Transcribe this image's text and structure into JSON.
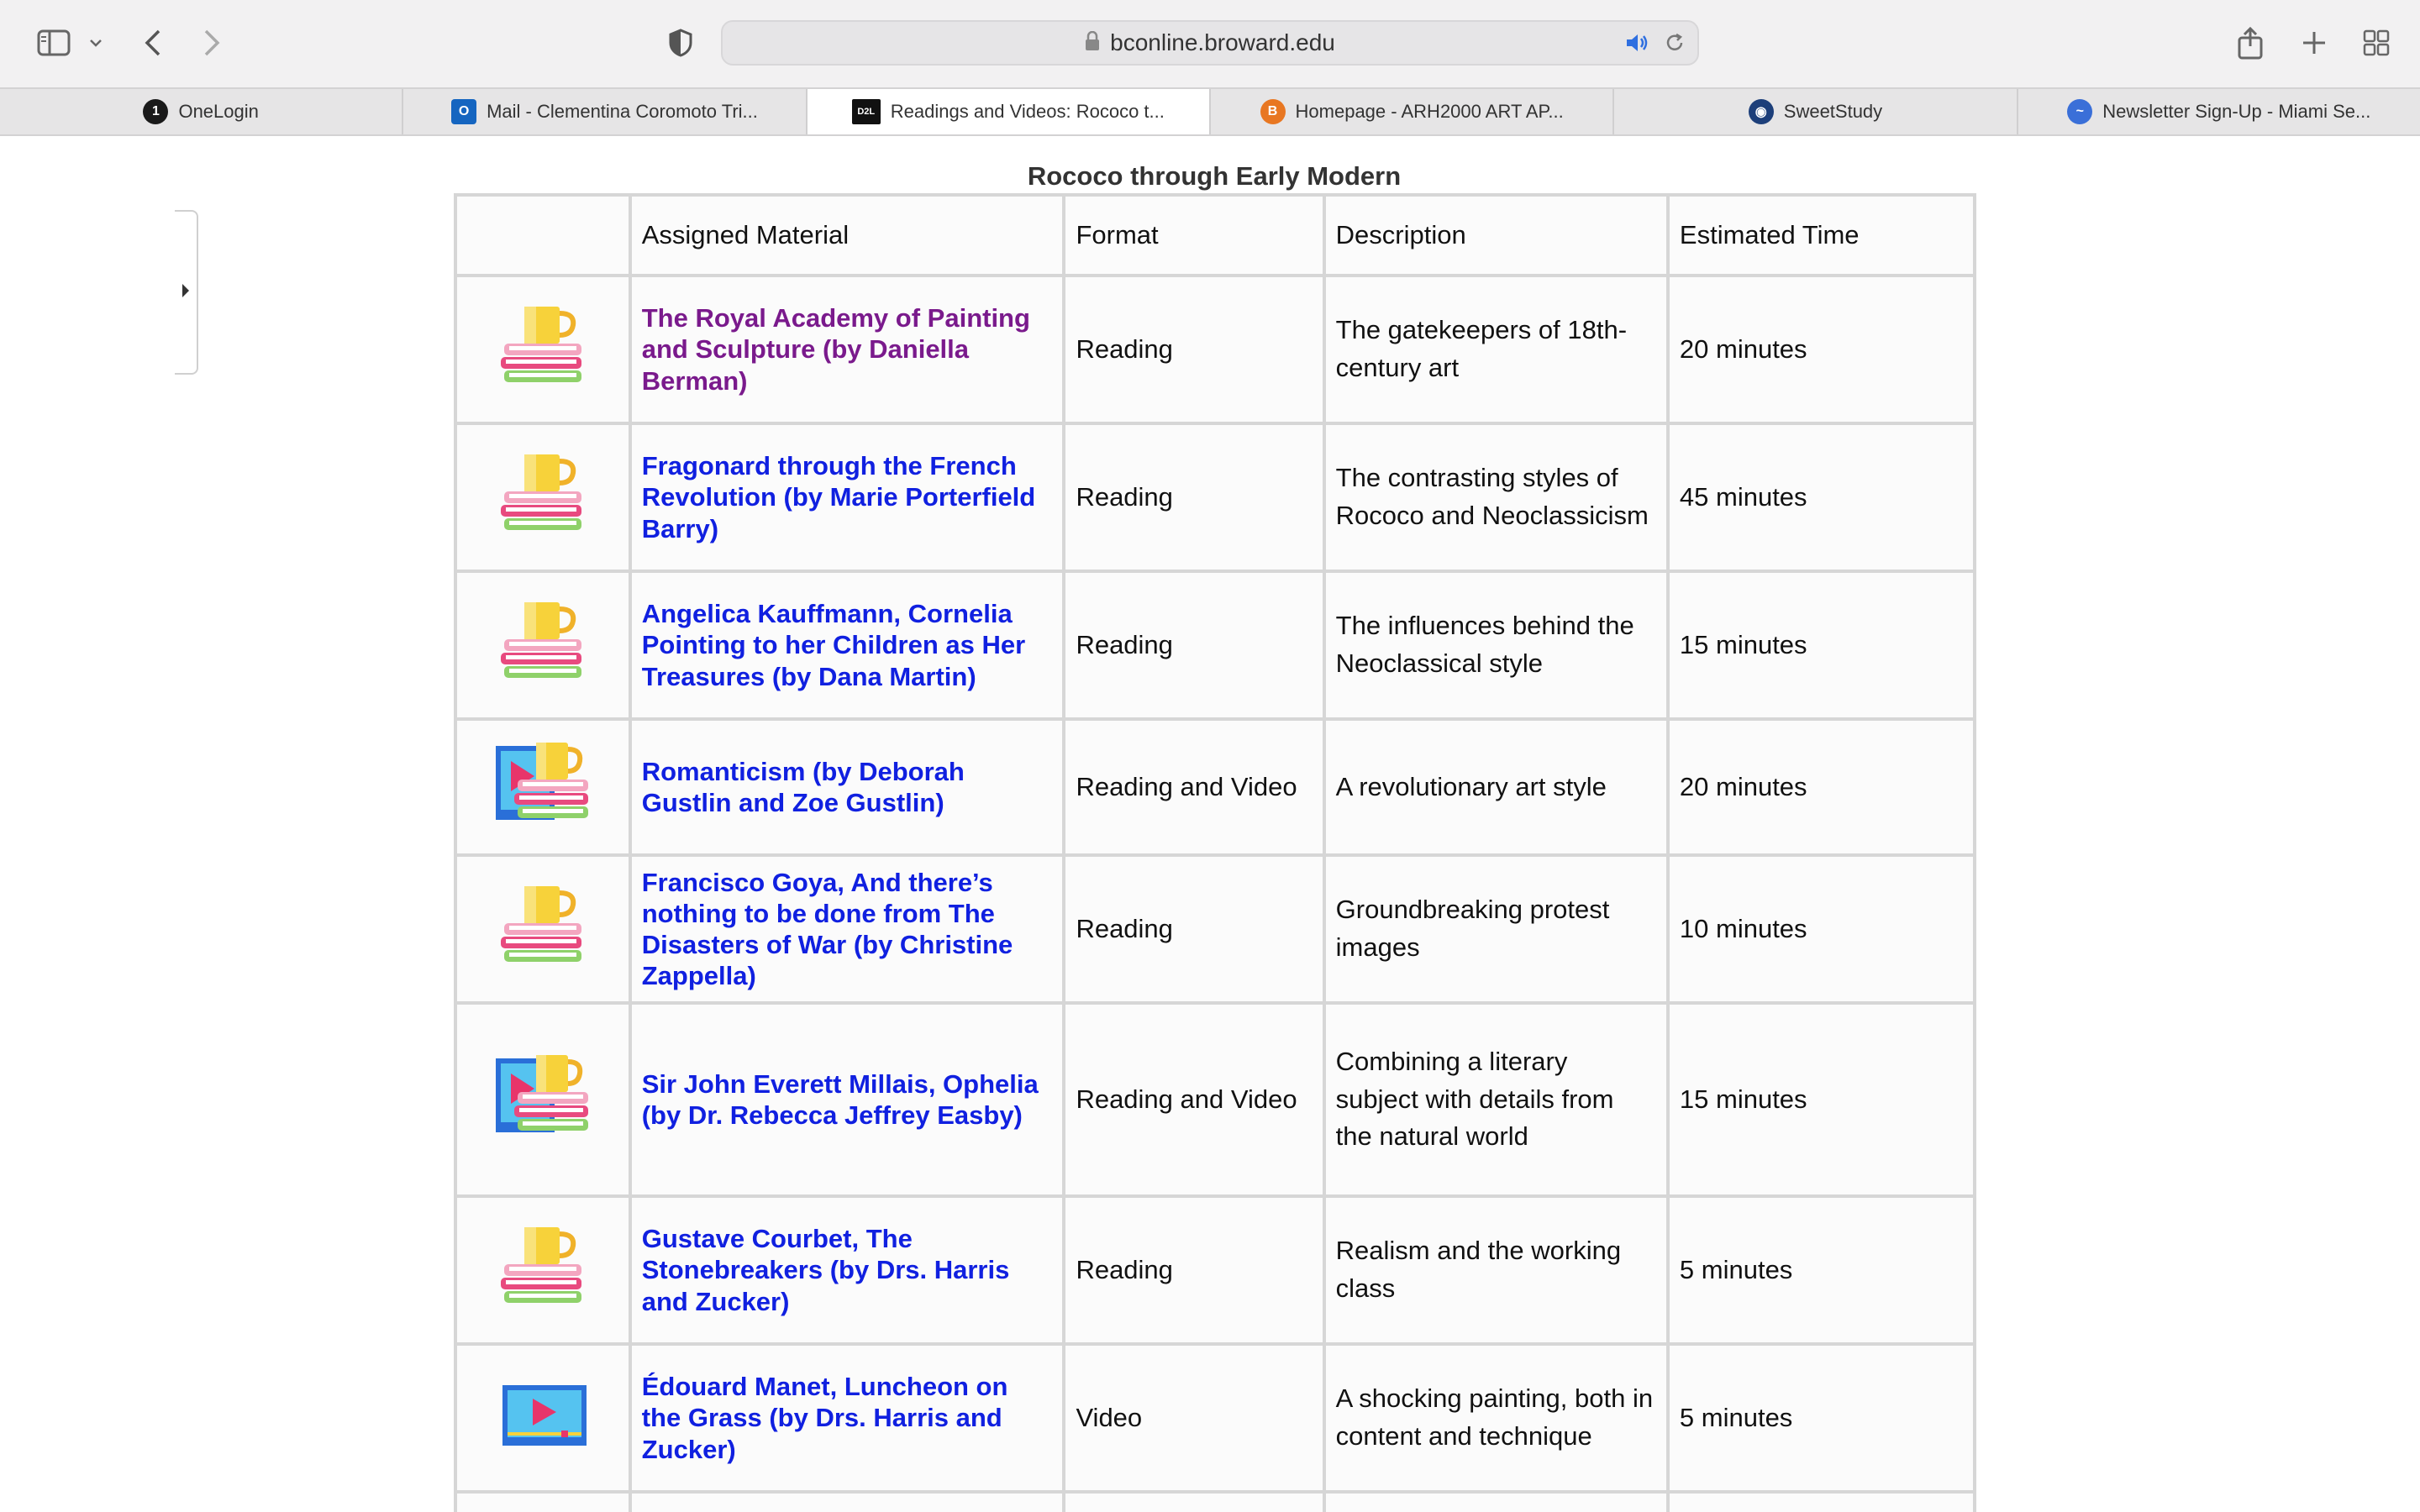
{
  "browser": {
    "url": "bconline.broward.edu",
    "tabs": [
      {
        "label": "OneLogin",
        "favicon": "onelogin-icon",
        "color": "#1a1a1a",
        "glyph": "1"
      },
      {
        "label": "Mail - Clementina Coromoto Tri...",
        "favicon": "outlook-icon",
        "color": "#1565c0",
        "glyph": "O"
      },
      {
        "label": "Readings and Videos: Rococo t...",
        "favicon": "d2l-icon",
        "color": "#111111",
        "glyph": "D2L",
        "active": true
      },
      {
        "label": "Homepage - ARH2000 ART AP...",
        "favicon": "b-icon",
        "color": "#e87722",
        "glyph": "B"
      },
      {
        "label": "SweetStudy",
        "favicon": "sweetstudy-icon",
        "color": "#1d3f7a",
        "glyph": "◉"
      },
      {
        "label": "Newsletter Sign-Up - Miami Se...",
        "favicon": "dolphin-icon",
        "color": "#3a6fd8",
        "glyph": "~"
      }
    ]
  },
  "table": {
    "caption": "Rococo through Early Modern",
    "headers": [
      "Assigned Material",
      "Format",
      "Description",
      "Estimated Time"
    ],
    "rows": [
      {
        "icon": "reading-icon",
        "title": "The Royal Academy of Painting and Sculpture (by Daniella Berman)",
        "visited": true,
        "format": "Reading",
        "description": "The gatekeepers of 18th-century art",
        "time": "20 minutes"
      },
      {
        "icon": "reading-icon",
        "title": "Fragonard through the French Revolution (by Marie Porterfield Barry)",
        "format": "Reading",
        "description": "The contrasting styles of Rococo and Neoclassicism",
        "time": "45 minutes"
      },
      {
        "icon": "reading-icon",
        "title": "Angelica Kauffmann, Cornelia Pointing to her Children as Her Treasures (by Dana Martin)",
        "format": "Reading",
        "description": "The influences behind the Neoclassical style",
        "time": "15 minutes"
      },
      {
        "icon": "reading-video-icon",
        "title": "Romanticism (by Deborah Gustlin and Zoe Gustlin)",
        "format": "Reading and Video",
        "description": "A revolutionary art style",
        "time": "20 minutes"
      },
      {
        "icon": "reading-icon",
        "title": "Francisco Goya, And there’s nothing to be done from The Disasters of War (by Christine Zappella)",
        "format": "Reading",
        "description": "Groundbreaking protest images",
        "time": "10 minutes"
      },
      {
        "icon": "reading-video-icon",
        "title": "Sir John Everett Millais, Ophelia (by Dr. Rebecca Jeffrey Easby)",
        "format": "Reading and Video",
        "description": "Combining a literary subject with details from the natural world",
        "time": "15 minutes"
      },
      {
        "icon": "reading-icon",
        "title": "Gustave Courbet, The Stonebreakers (by Drs. Harris and Zucker)",
        "format": "Reading",
        "description": "Realism and the working class",
        "time": "5 minutes"
      },
      {
        "icon": "video-icon",
        "title": "Édouard Manet, Luncheon on the Grass (by Drs. Harris and Zucker)",
        "format": "Video",
        "description": "A shocking painting, both in content and technique",
        "time": "5 minutes"
      }
    ]
  }
}
